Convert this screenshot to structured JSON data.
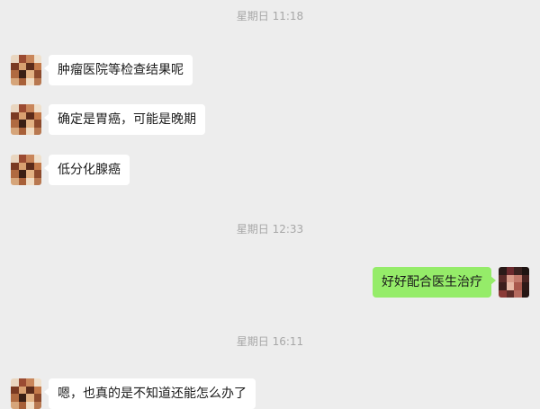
{
  "timestamps": [
    "星期日 11:18",
    "星期日 12:33",
    "星期日 16:11"
  ],
  "messages": [
    {
      "side": "left",
      "text": "肿瘤医院等检查结果呢"
    },
    {
      "side": "left",
      "text": "确定是胃癌，可能是晚期"
    },
    {
      "side": "left",
      "text": "低分化腺癌"
    },
    {
      "side": "right",
      "text": "好好配合医生治疗"
    },
    {
      "side": "left",
      "text": "嗯，也真的是不知道还能怎么办了"
    }
  ],
  "colors": {
    "background": "#ededed",
    "incoming_bubble": "#ffffff",
    "outgoing_bubble": "#95ec69",
    "timestamp": "#a7a7a7"
  },
  "icons": {
    "contact_avatar": "pixelated-contact-avatar",
    "self_avatar": "pixelated-self-avatar"
  }
}
